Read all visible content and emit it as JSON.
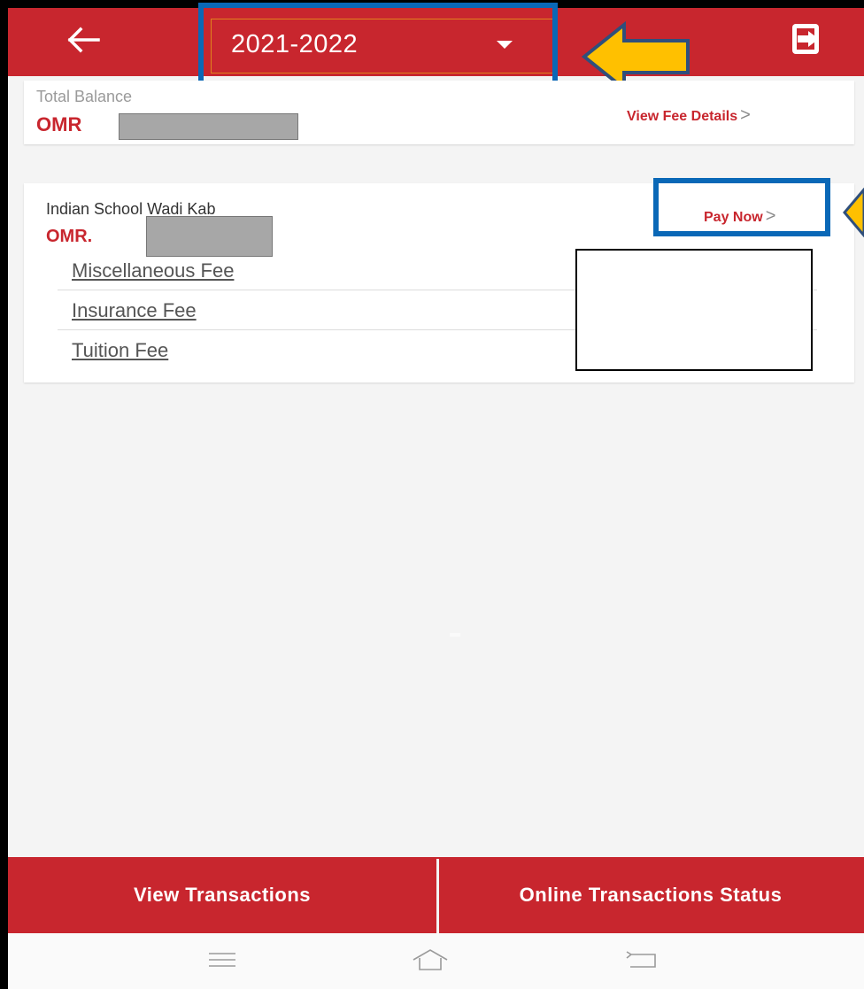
{
  "header": {
    "year_selected": "2021-2022",
    "back_icon": "back-arrow-icon",
    "caret_icon": "caret-down-icon",
    "logout_icon": "logout-icon"
  },
  "balance": {
    "label": "Total Balance",
    "currency": "OMR",
    "view_fee_details": "View Fee Details",
    "chevron": ">"
  },
  "school": {
    "name": "Indian School Wadi Kab",
    "amount_prefix": "OMR.",
    "pay_now": "Pay Now",
    "chevron": ">",
    "fees": [
      {
        "label": "Miscellaneous Fee"
      },
      {
        "label": "Insurance Fee"
      },
      {
        "label": "Tuition Fee"
      }
    ]
  },
  "actions": {
    "view_transactions": "View Transactions",
    "online_status": "Online Transactions Status"
  },
  "nav": {
    "menu_icon": "menu-icon",
    "home_icon": "home-icon",
    "back_icon": "back-icon"
  },
  "colors": {
    "brand_red": "#c8262e",
    "highlight_blue": "#0a68b7",
    "arrow_yellow": "#ffc000"
  }
}
